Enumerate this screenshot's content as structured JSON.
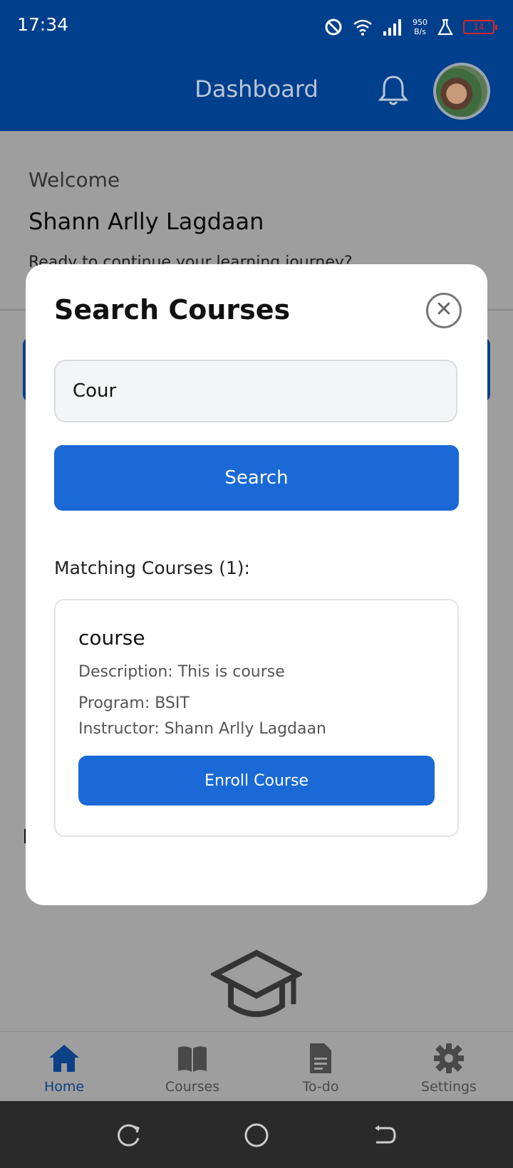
{
  "status_bar": {
    "time": "17:34",
    "net_speed_value": "950",
    "net_speed_unit": "B/s",
    "battery": "14",
    "icons": [
      "do-not-disturb-icon",
      "wifi-icon",
      "signal-icon",
      "flask-icon",
      "battery-icon"
    ]
  },
  "header": {
    "title": "Dashboard",
    "icons": [
      "bell-icon",
      "avatar"
    ]
  },
  "page": {
    "welcome": "Welcome",
    "user_name": "Shann Arlly Lagdaan",
    "tagline": "Ready to continue your learning journey?"
  },
  "modal": {
    "title": "Search Courses",
    "search_value": "Cour",
    "search_button": "Search",
    "matching_label": "Matching Courses (1):",
    "courses": [
      {
        "name": "course",
        "description": "Description: This is course",
        "program": "Program: BSIT",
        "instructor": "Instructor: Shann Arlly Lagdaan",
        "enroll_label": "Enroll Course"
      }
    ]
  },
  "bottom_nav": {
    "items": [
      {
        "label": "Home",
        "icon": "home-icon",
        "active": true
      },
      {
        "label": "Courses",
        "icon": "book-icon",
        "active": false
      },
      {
        "label": "To-do",
        "icon": "document-icon",
        "active": false
      },
      {
        "label": "Settings",
        "icon": "gear-icon",
        "active": false
      }
    ]
  },
  "colors": {
    "primary": "#1a69d6",
    "header": "#003f8c",
    "battery_low": "#d62828"
  }
}
